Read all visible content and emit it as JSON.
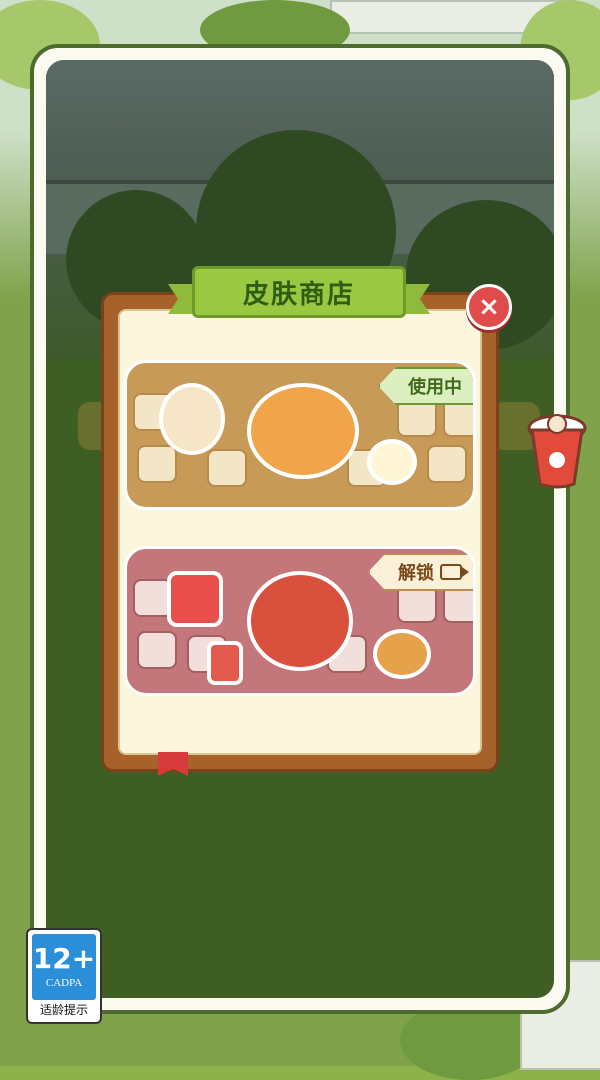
{
  "shop": {
    "title": "皮肤商店",
    "close_icon": "×",
    "skins": [
      {
        "name": "hamster-bread-skin",
        "status_label": "使用中",
        "state": "in-use"
      },
      {
        "name": "mushroom-fruit-skin",
        "status_label": "解锁",
        "state": "locked",
        "unlock_method_icon": "video-icon"
      }
    ]
  },
  "rating": {
    "age": "12+",
    "org": "CADPA",
    "tip": "适龄提示"
  },
  "colors": {
    "modal_wood": "#a6622a",
    "title_green": "#9bc843",
    "close_red": "#e04b4b",
    "card_one_bg": "#c89a57",
    "card_two_bg": "#c4777a",
    "rating_blue": "#2a8fd8"
  }
}
